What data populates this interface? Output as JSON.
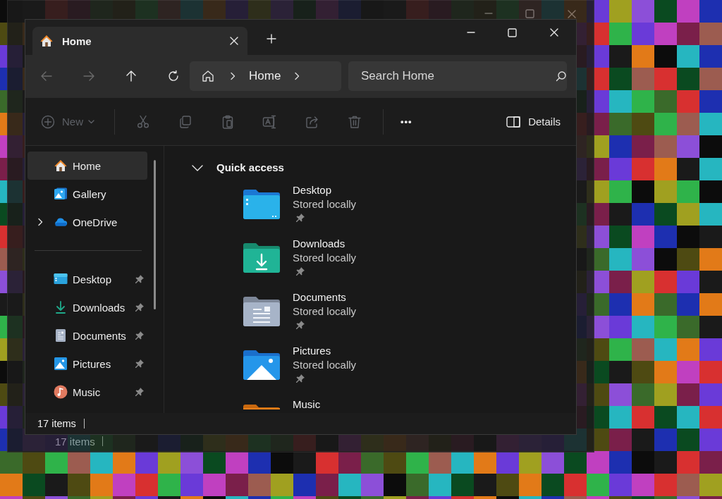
{
  "back_window": {
    "status_bar": {
      "item_count": "17 items"
    }
  },
  "window": {
    "tabs": [
      {
        "label": "Home",
        "selected": true
      }
    ],
    "navigation": [
      {
        "kind": "back",
        "disabled": true
      },
      {
        "kind": "forward",
        "disabled": true
      },
      {
        "kind": "up",
        "disabled": false
      },
      {
        "kind": "refresh",
        "disabled": false
      }
    ],
    "address_bar": {
      "breadcrumbs": [
        "Home"
      ]
    },
    "search": {
      "placeholder": "Search Home"
    },
    "toolbar": [
      {
        "kind": "new",
        "label": "New",
        "disabled": true
      },
      {
        "kind": "cut",
        "disabled": true
      },
      {
        "kind": "copy",
        "disabled": true
      },
      {
        "kind": "paste",
        "disabled": true
      },
      {
        "kind": "rename",
        "disabled": true
      },
      {
        "kind": "share",
        "disabled": true
      },
      {
        "kind": "delete",
        "disabled": true
      },
      {
        "kind": "more",
        "label": "•••",
        "disabled": false
      },
      {
        "kind": "details",
        "label": "Details",
        "disabled": false
      }
    ],
    "sidebar": {
      "items": [
        {
          "label": "Home",
          "kind": "home",
          "selected": true,
          "expandable": false
        },
        {
          "label": "Gallery",
          "kind": "gallery",
          "selected": false,
          "expandable": false
        },
        {
          "label": "OneDrive",
          "kind": "onedrive",
          "selected": false,
          "expandable": true
        }
      ],
      "pinned_items": [
        {
          "label": "Desktop",
          "kind": "desktop",
          "selected": false,
          "pinned": true
        },
        {
          "label": "Downloads",
          "kind": "downloads",
          "selected": false,
          "pinned": true
        },
        {
          "label": "Documents",
          "kind": "documents",
          "selected": false,
          "pinned": true
        },
        {
          "label": "Pictures",
          "kind": "pictures",
          "selected": false,
          "pinned": true
        },
        {
          "label": "Music",
          "kind": "music",
          "selected": false,
          "pinned": true
        }
      ]
    },
    "quick_access": {
      "title": "Quick access",
      "expanded": true,
      "items": [
        {
          "name": "Desktop",
          "status": "Stored locally",
          "kind": "desktop",
          "pinned": true
        },
        {
          "name": "Downloads",
          "status": "Stored locally",
          "kind": "downloads",
          "pinned": true
        },
        {
          "name": "Documents",
          "status": "Stored locally",
          "kind": "documents",
          "pinned": true
        },
        {
          "name": "Pictures",
          "status": "Stored locally",
          "kind": "pictures",
          "pinned": true
        },
        {
          "name": "Music",
          "kind": "music"
        }
      ]
    },
    "status_bar": {
      "item_count": "17 items"
    }
  }
}
